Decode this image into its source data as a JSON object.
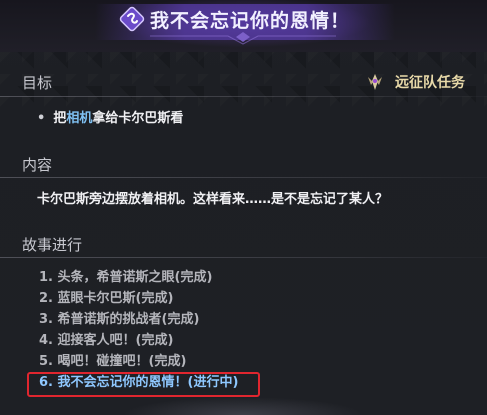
{
  "banner": {
    "title": "我不会忘记你的恩情！",
    "icon": "quest-swirl-icon"
  },
  "objective": {
    "header": "目标",
    "tag": {
      "label": "远征队任务",
      "icon": "expedition-crest-icon"
    },
    "item": {
      "bullet": "•",
      "prefix": "把",
      "highlight": "相机",
      "suffix": "拿给卡尔巴斯看"
    }
  },
  "content": {
    "header": "内容",
    "text": "卡尔巴斯旁边摆放着相机。这样看来……是不是忘记了某人？"
  },
  "story": {
    "header": "故事进行",
    "items": [
      {
        "label": "1. 头条，希普诺斯之眼(完成)"
      },
      {
        "label": "2. 蓝眼卡尔巴斯(完成)"
      },
      {
        "label": "3. 希普诺斯的挑战者(完成)"
      },
      {
        "label": "4. 迎接客人吧！(完成)"
      },
      {
        "label": "5. 喝吧！碰撞吧！(完成)"
      },
      {
        "label": "6. 我不会忘记你的恩情！(进行中)"
      }
    ]
  },
  "colors": {
    "background": "#1d1f24",
    "banner_purple": "#5a3caa",
    "highlight_blue": "#7fc0f2",
    "active_item": "#8fc8ff",
    "completed_item": "#b4b5bb",
    "tag_gold": "#e8d9a8",
    "annotation_red": "#e0262f"
  }
}
